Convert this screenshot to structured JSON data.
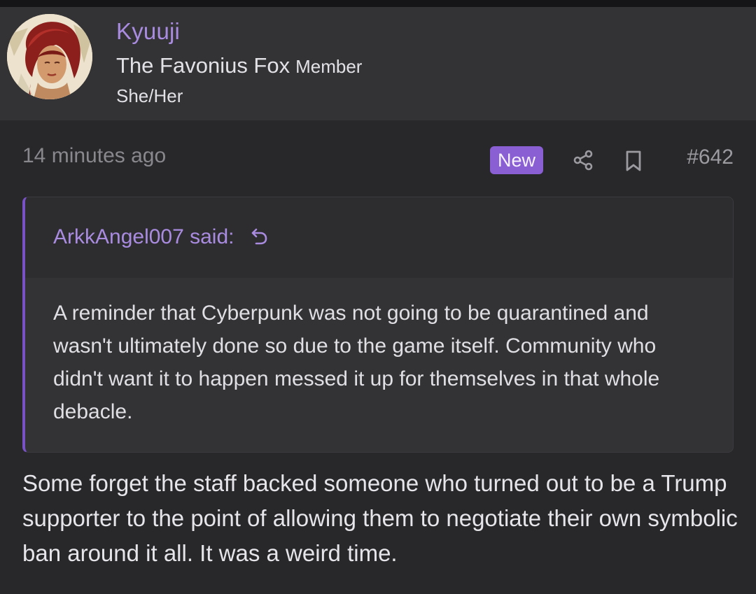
{
  "user": {
    "name": "Kyuuji",
    "title": "The Favonius Fox",
    "rank": "Member",
    "pronouns": "She/Her"
  },
  "post": {
    "time": "14 minutes ago",
    "badge": "New",
    "number": "#642",
    "icons": [
      "share-icon",
      "bookmark-icon"
    ],
    "quote": {
      "author_line": "ArkkAngel007 said:",
      "text": "A reminder that Cyberpunk was not going to be quarantined and wasn't ultimately done so due to the game itself. Community who didn't want it to happen messed it up for themselves in that whole debacle."
    },
    "body": "Some forget the staff backed someone who turned out to be a Trump supporter to the point of allowing them to negotiate their own symbolic ban around it all. It was a weird time."
  },
  "colors": {
    "accent": "#a98be0",
    "badge": "#8a5fd3",
    "quote_bar": "#7a52c7",
    "background": "#28282b",
    "header": "#333336"
  }
}
